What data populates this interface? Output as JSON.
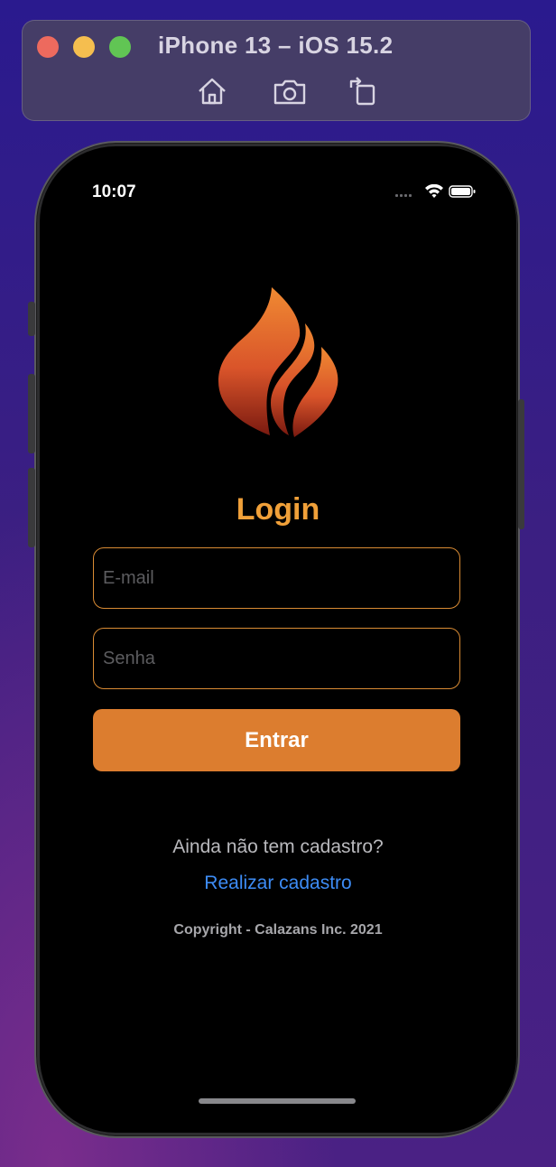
{
  "simulator": {
    "title": "iPhone 13 – iOS 15.2",
    "tools": [
      "home-icon",
      "screenshot-icon",
      "rotate-icon"
    ]
  },
  "status_bar": {
    "time": "10:07",
    "icons": [
      "signal-icon",
      "wifi-icon",
      "battery-icon"
    ]
  },
  "app": {
    "logo": "flame-logo",
    "title": "Login",
    "email_placeholder": "E-mail",
    "password_placeholder": "Senha",
    "submit_label": "Entrar",
    "register_prompt": "Ainda não tem cadastro?",
    "register_link": "Realizar cadastro",
    "copyright": "Copyright - Calazans Inc. 2021"
  },
  "colors": {
    "accent": "#dc7d2f",
    "title": "#f0a039",
    "link": "#3d8cf5",
    "background": "#000000"
  }
}
